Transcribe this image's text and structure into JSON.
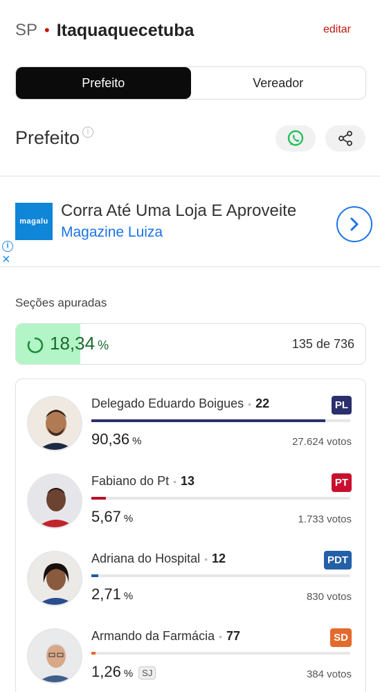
{
  "header": {
    "state": "SP",
    "city": "Itaquaquecetuba",
    "edit_label": "editar"
  },
  "tabs": [
    {
      "label": "Prefeito",
      "active": true
    },
    {
      "label": "Vereador",
      "active": false
    }
  ],
  "section": {
    "title": "Prefeito",
    "info_icon": "info-icon",
    "whatsapp_icon": "whatsapp-icon",
    "share_icon": "share-icon"
  },
  "ad": {
    "logo_text": "magalu",
    "title": "Corra Até Uma Loja E Aproveite",
    "advertiser": "Magazine Luiza",
    "arrow_icon": "chevron-right-icon",
    "info_glyph": "i",
    "close_glyph": "×"
  },
  "sections_counted": {
    "label": "Seções apuradas",
    "percent": "18,34",
    "percent_symbol": "%",
    "percent_value": 18.34,
    "count_text": "135 de 736"
  },
  "candidates": [
    {
      "name": "Delegado Eduardo Boigues",
      "number": "22",
      "party": "PL",
      "party_color": "#2b2f6b",
      "percent": "90,36",
      "percent_value": 90.36,
      "votes": "27.624 votos",
      "bar_color": "#2b2f6b"
    },
    {
      "name": "Fabiano do Pt",
      "number": "13",
      "party": "PT",
      "party_color": "#c8102e",
      "percent": "5,67",
      "percent_value": 5.67,
      "votes": "1.733 votos",
      "bar_color": "#b8102a"
    },
    {
      "name": "Adriana do Hospital",
      "number": "12",
      "party": "PDT",
      "party_color": "#2360a8",
      "percent": "2,71",
      "percent_value": 2.71,
      "votes": "830 votos",
      "bar_color": "#1f5aa0"
    },
    {
      "name": "Armando da Farmácia",
      "number": "77",
      "party": "SD",
      "party_color": "#e46a2c",
      "percent": "1,26",
      "percent_value": 1.26,
      "votes": "384 votos",
      "bar_color": "#e46a2c",
      "tag": "SJ"
    }
  ],
  "percent_symbol": "%"
}
